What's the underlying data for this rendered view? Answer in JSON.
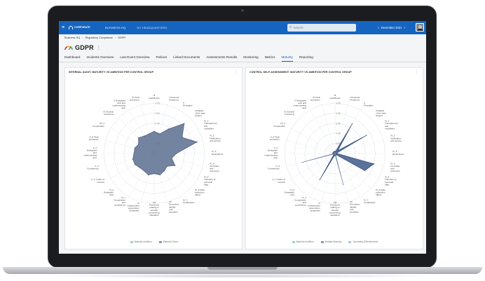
{
  "topbar": {
    "logo_line1": "CORPORATE",
    "logo_line2": "",
    "link1": "BUSINESS HQ",
    "link2": "NY HEADQUARTERS",
    "search_placeholder": "Search",
    "date_label": "December 2021"
  },
  "breadcrumb": [
    "Business HQ",
    "Regulatory Compliance",
    "GDPR"
  ],
  "page": {
    "title": "GDPR"
  },
  "tabs": [
    "Dashboard",
    "Incidents Overview",
    "Last Event Overview",
    "Policies",
    "Linked Documents",
    "Assessments Results",
    "Monitoring",
    "Metrics",
    "Maturity",
    "Reporting"
  ],
  "active_tab": 8,
  "left_panel": {
    "title": "INTERNAL AUDIT: MATURITY VS AMBITION PER CONTROL GROUP",
    "legend": [
      "Maturity Audition",
      "Maturity Score"
    ]
  },
  "right_panel": {
    "title": "CONTROL SELF-ASSESSMENT: MATURITY VS AMBITION PER CONTROL GROUP",
    "legend": [
      "Maturity Audition",
      "Budget Maturity",
      "Operating Effectiveness"
    ]
  },
  "chart_data": [
    {
      "type": "radar",
      "title": "INTERNAL AUDIT: MATURITY VS AMBITION PER CONTROL GROUP",
      "categories": [
        "III Lawfulness",
        "I Personal Freedoms",
        "II Principles",
        "III Rights of the data subject",
        "IV_1 Transparency and modalities",
        "IV_2 Notification and access",
        "IV_3 Restrictions",
        "IV_4 Controller and processor",
        "IV_5 Transfers of personal data",
        "IV_6 Data protection officer",
        "IV_7 Certification",
        "VII Remedies, liability and penalties",
        "VIII Provisions relating to specific processing situations",
        "VI Independent supervisory authorities",
        "VI_1 Cooperation and consistency",
        "VI_2 Delegated acts",
        "V_1 Codes of conduct",
        "V_3 Consistency",
        "V_4 Delegated and implementing acts",
        "V_5 Final provisions",
        "VII_1 Cooperation",
        "IX General provisions",
        "X Delegated acts and implementing acts",
        "XI Final provisions"
      ],
      "rings": [
        "0.25",
        "0.50",
        "0.75",
        "1.00",
        "1.25"
      ],
      "rmax": 1.25,
      "series": [
        {
          "name": "Maturity Score",
          "values": [
            0.55,
            0.5,
            0.7,
            1.05,
            0.8,
            1.1,
            0.55,
            0.45,
            0.6,
            0.45,
            0.5,
            0.55,
            0.5,
            0.55,
            0.5,
            0.5,
            0.55,
            0.55,
            0.5,
            0.5,
            0.45,
            0.55,
            0.5,
            0.5
          ]
        }
      ]
    },
    {
      "type": "radar",
      "title": "CONTROL SELF-ASSESSMENT: MATURITY VS AMBITION PER CONTROL GROUP",
      "categories": [
        "III Lawfulness",
        "I Personal Freedoms",
        "II Principles",
        "III Rights of the data subject",
        "IV_1 Transparency and modalities",
        "IV_2 Notification and access",
        "IV_3 Restrictions",
        "IV_4 Controller and processor",
        "IV_5 Transfers of personal data",
        "IV_6 Data protection officer",
        "IV_7 Certification",
        "VII Remedies, liability and penalties",
        "VIII Provisions relating to specific processing situations",
        "VI Independent supervisory authorities",
        "VI_1 Cooperation and consistency",
        "VI_2 Delegated acts",
        "V_1 Codes of conduct",
        "V_3 Consistency",
        "V_4 Delegated and implementing acts",
        "V_5 Final provisions",
        "VII_1 Cooperation",
        "IX General provisions",
        "X Delegated acts and implementing acts",
        "XI Final provisions"
      ],
      "rings": [
        "0.50",
        "1.00",
        "1.50",
        "2.00",
        "2.50"
      ],
      "rmax": 2.5,
      "series": [
        {
          "name": "Maturity Audition",
          "values": [
            0.1,
            0.1,
            1.7,
            0.2,
            1.8,
            0.1,
            0.1,
            2.0,
            1.7,
            0.1,
            0.1,
            0.1,
            0.1,
            0.1,
            1.5,
            0.1,
            0.1,
            0.1,
            0.1,
            0.1,
            0.1,
            0.1,
            0.1,
            0.1
          ]
        },
        {
          "name": "Operating Effectiveness",
          "values": [
            0.05,
            0.05,
            0.05,
            0.05,
            0.05,
            0.05,
            0.05,
            0.05,
            0.05,
            0.05,
            0.05,
            1.6,
            0.05,
            0.05,
            0.05,
            0.05,
            0.05,
            1.7,
            0.05,
            0.05,
            0.05,
            0.05,
            0.05,
            0.05
          ]
        }
      ]
    }
  ],
  "colors": {
    "brand": "#1565c0",
    "fill_left": "#5a6f8f",
    "fill_right": "#3d5a8a",
    "grid": "#d8dde4"
  }
}
